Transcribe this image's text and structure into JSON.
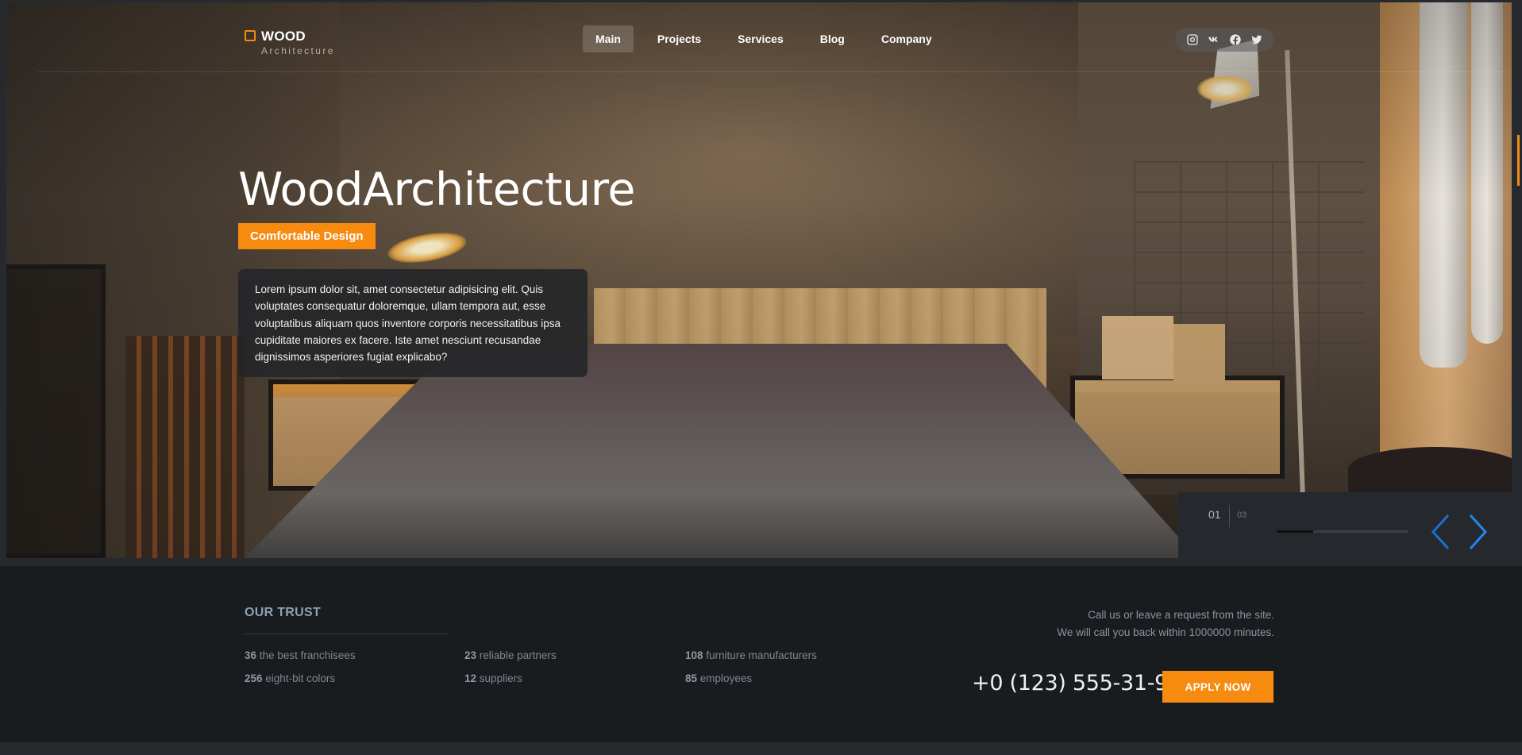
{
  "logo": {
    "title": "WOOD",
    "subtitle": "Architecture"
  },
  "nav": {
    "items": [
      "Main",
      "Projects",
      "Services",
      "Blog",
      "Company"
    ],
    "active": "Main"
  },
  "socials": [
    "instagram-icon",
    "vk-icon",
    "facebook-icon",
    "twitter-icon"
  ],
  "hero": {
    "title": "WoodArchitecture",
    "badge": "Comfortable Design",
    "description": "Lorem ipsum dolor sit, amet consectetur adipisicing elit. Quis voluptates consequatur doloremque, ullam tempora aut, esse voluptatibus aliquam quos inventore corporis necessitatibus ipsa cupiditate maiores ex facere. Iste amet nesciunt recusandae dignissimos asperiores fugiat explicabo?"
  },
  "slider": {
    "current": "01",
    "total": "03",
    "progress": 0.28,
    "prev_icon": "chevron-left-icon",
    "next_icon": "chevron-right-icon"
  },
  "trust": {
    "title": "OUR TRUST",
    "stats": [
      {
        "value": "36",
        "label": "the best franchisees"
      },
      {
        "value": "23",
        "label": "reliable partners"
      },
      {
        "value": "108",
        "label": "furniture manufacturers"
      },
      {
        "value": "256",
        "label": "eight-bit colors"
      },
      {
        "value": "12",
        "label": "suppliers"
      },
      {
        "value": "85",
        "label": "employees"
      }
    ],
    "call_line_1": "Call us or leave a request from the site.",
    "call_line_2": "We will call you back within 1000000 minutes.",
    "phone": "+0 (123) 555-31-91",
    "apply_label": "APPLY NOW"
  },
  "colors": {
    "accent": "#f68b0f",
    "dark": "#181c1f",
    "arrow": "#1e7fe8"
  }
}
